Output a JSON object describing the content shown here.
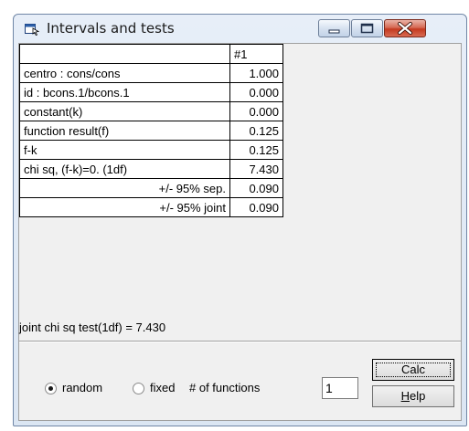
{
  "window": {
    "title": "Intervals and tests"
  },
  "grid": {
    "column_header": "#1",
    "rows": [
      {
        "label": "centro : cons/cons",
        "value": "1.000",
        "align": "left"
      },
      {
        "label": "id : bcons.1/bcons.1",
        "value": "0.000",
        "align": "left"
      },
      {
        "label": "constant(k)",
        "value": "0.000",
        "align": "left"
      },
      {
        "label": "function result(f)",
        "value": "0.125",
        "align": "left"
      },
      {
        "label": "f-k",
        "value": "0.125",
        "align": "left"
      },
      {
        "label": "chi sq, (f-k)=0. (1df)",
        "value": "7.430",
        "align": "left"
      },
      {
        "label": "+/- 95% sep.",
        "value": "0.090",
        "align": "right"
      },
      {
        "label": "+/- 95% joint",
        "value": "0.090",
        "align": "right"
      }
    ]
  },
  "status": {
    "text": "joint chi sq test(1df) = 7.430"
  },
  "options": {
    "random_label": "random",
    "fixed_label": "fixed",
    "selected": "random",
    "functions_label": "# of functions",
    "functions_value": "1"
  },
  "buttons": {
    "calc": "Calc",
    "help_prefix": "",
    "help_accel": "H",
    "help_rest": "elp"
  }
}
